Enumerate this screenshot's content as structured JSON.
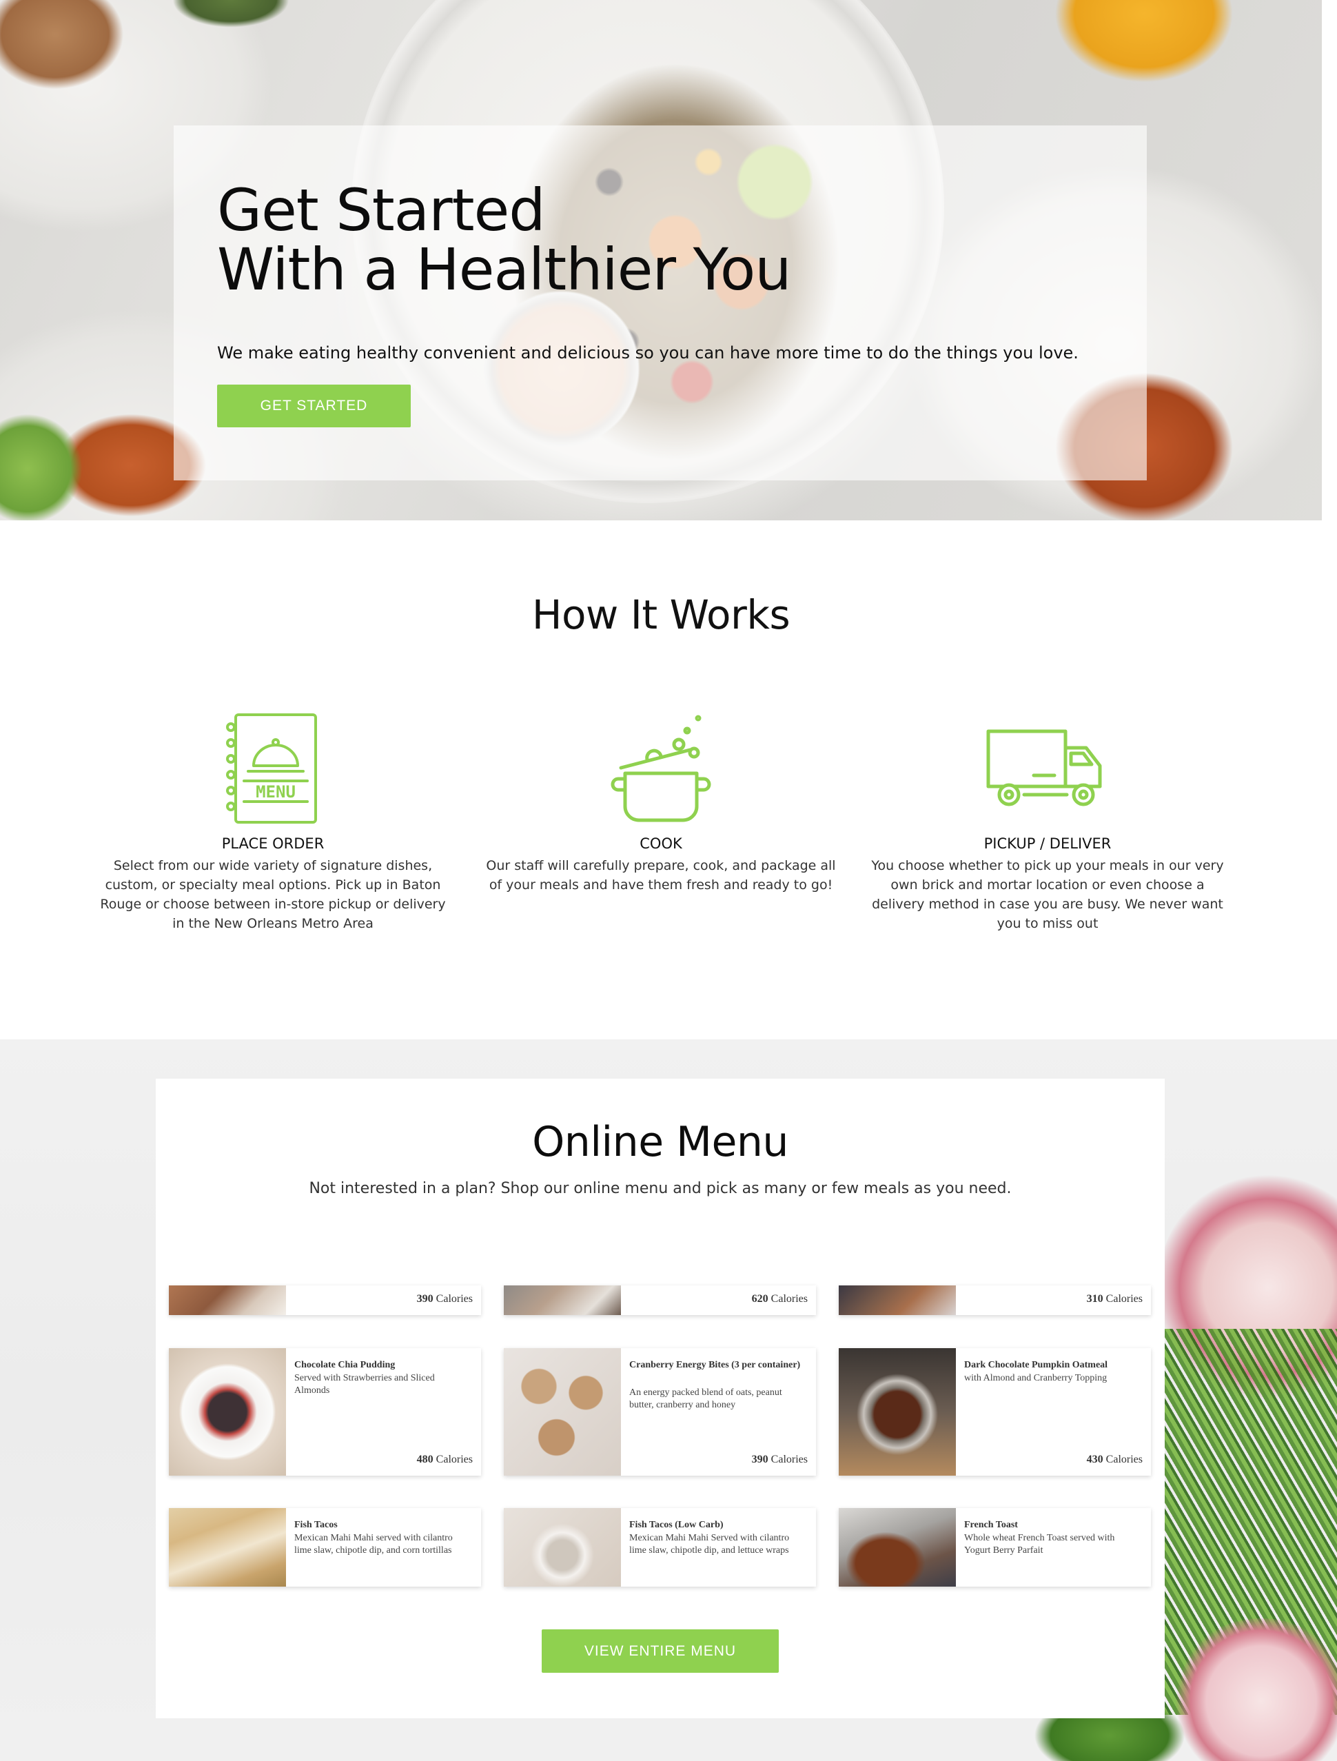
{
  "hero": {
    "title": "Get Started\nWith a Healthier You",
    "subtitle": "We make eating healthy convenient and delicious so you can have more time to do the things you love.",
    "cta_label": "GET STARTED"
  },
  "how_it_works": {
    "title": "How It Works",
    "menu_icon_text": "MENU",
    "steps": [
      {
        "icon": "menu-book-icon",
        "title": "PLACE ORDER",
        "desc": "Select from our wide variety of signature dishes, custom, or specialty meal options. Pick up in Baton Rouge or choose between in-store pickup or delivery in the New Orleans Metro Area"
      },
      {
        "icon": "cooking-pot-icon",
        "title": "COOK",
        "desc": "Our staff will carefully prepare, cook, and package all of your meals and have them fresh and ready to go!"
      },
      {
        "icon": "delivery-truck-icon",
        "title": "PICKUP / DELIVER",
        "desc": "You choose whether to pick up your meals in our very own brick and mortar location or even choose a delivery method in case you are busy. We never want you to miss out"
      }
    ]
  },
  "online_menu": {
    "title": "Online Menu",
    "subtitle": "Not interested in a plan? Shop our online menu and pick as many or few meals as you need.",
    "calories_unit": "Calories",
    "top_row_calories": [
      "390",
      "620",
      "310"
    ],
    "items": [
      {
        "name": "Chocolate Chia Pudding",
        "desc": "Served with Strawberries and Sliced Almonds",
        "calories": "480"
      },
      {
        "name": "Cranberry Energy Bites (3 per container)",
        "desc": "An energy packed blend of oats, peanut butter, cranberry and honey",
        "calories": "390"
      },
      {
        "name": "Dark Chocolate Pumpkin Oatmeal",
        "desc": "with Almond and Cranberry Topping",
        "calories": "430"
      },
      {
        "name": "Fish Tacos",
        "desc": "Mexican Mahi Mahi served with cilantro lime slaw, chipotle dip, and corn tortillas"
      },
      {
        "name": "Fish Tacos (Low Carb)",
        "desc": "Mexican Mahi Mahi Served with cilantro lime slaw, chipotle dip, and lettuce wraps"
      },
      {
        "name": "French Toast",
        "desc": "Whole wheat French Toast served with Yogurt Berry Parfait"
      }
    ],
    "view_all_label": "VIEW ENTIRE MENU"
  },
  "colors": {
    "accent": "#8fd14f",
    "text": "#111111"
  }
}
